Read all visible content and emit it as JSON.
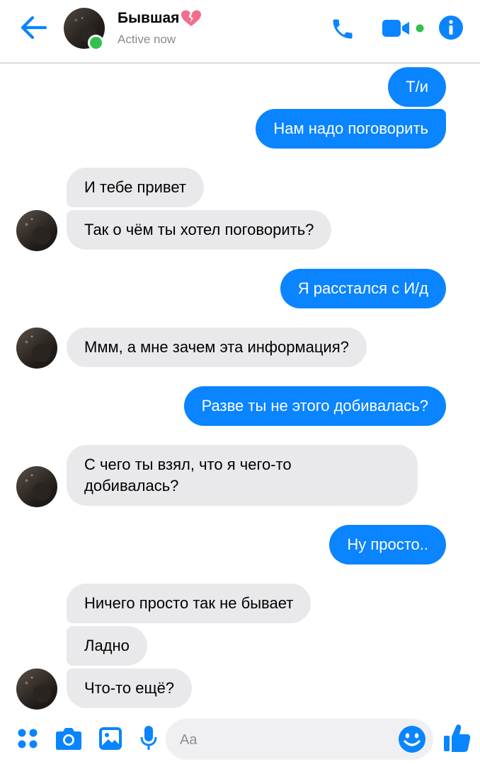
{
  "header": {
    "contact_name": "Бывшая",
    "status": "Active now",
    "icons": [
      "back-arrow-icon",
      "phone-icon",
      "video-camera-icon",
      "info-icon",
      "broken-heart-icon"
    ]
  },
  "messages": [
    {
      "side": "out",
      "text": "Т/и"
    },
    {
      "side": "out",
      "text": "Нам надо поговорить"
    },
    {
      "side": "in",
      "text": "И тебе привет"
    },
    {
      "side": "in",
      "text": "Так о чём ты хотел поговорить?"
    },
    {
      "side": "out",
      "text": "Я расстался с И/д"
    },
    {
      "side": "in",
      "text": "Ммм, а мне зачем эта информация?"
    },
    {
      "side": "out",
      "text": "Разве ты не этого добивалась?"
    },
    {
      "side": "in",
      "text": "С чего ты взял, что я чего-то"
    },
    {
      "side": "in",
      "text": "добивалась?"
    },
    {
      "side": "out",
      "text": "Ну просто.."
    },
    {
      "side": "in",
      "text": "Ничего просто так не бывает"
    },
    {
      "side": "in",
      "text": "Ладно"
    },
    {
      "side": "in",
      "text": "Что-то ещё?"
    }
  ],
  "composer": {
    "placeholder": "Aa",
    "icons": [
      "apps-icon",
      "camera-icon",
      "gallery-icon",
      "microphone-icon",
      "emoji-icon",
      "thumbs-up-icon"
    ]
  },
  "colors": {
    "accent": "#0a84ff",
    "incoming_bubble": "#e9e9eb",
    "online": "#31c24d",
    "heart": "#f06f8f"
  }
}
